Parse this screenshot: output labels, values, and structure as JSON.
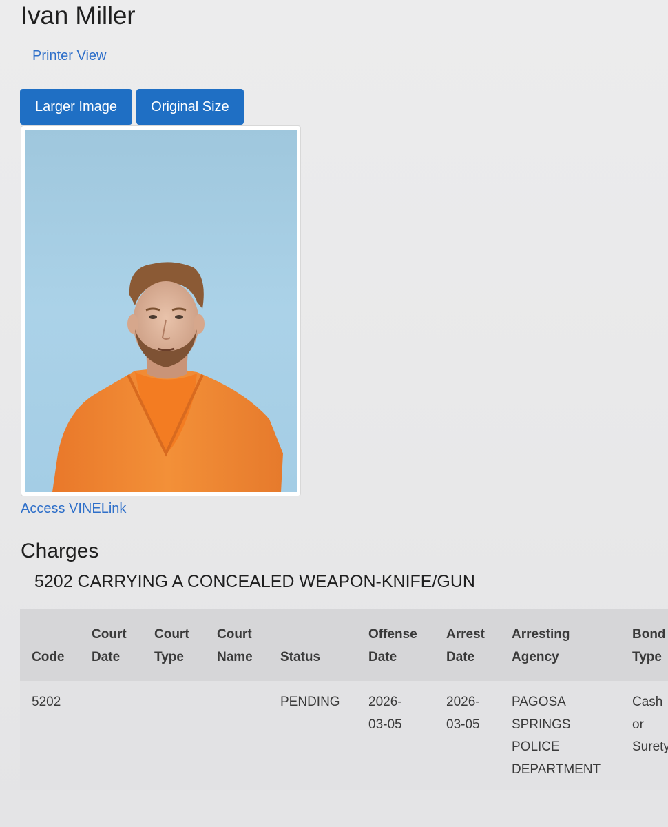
{
  "header": {
    "name": "Ivan Miller",
    "printer_link": "Printer View"
  },
  "buttons": {
    "larger_image": "Larger Image",
    "original_size": "Original Size"
  },
  "links": {
    "vinelink": "Access VINELink"
  },
  "charges": {
    "heading": "Charges",
    "charge_title": "5202 CARRYING A CONCEALED WEAPON-KNIFE/GUN",
    "columns": [
      {
        "line1": "",
        "line2": "Code"
      },
      {
        "line1": "Court",
        "line2": "Date"
      },
      {
        "line1": "Court",
        "line2": "Type"
      },
      {
        "line1": "Court",
        "line2": "Name"
      },
      {
        "line1": "",
        "line2": "Status"
      },
      {
        "line1": "Offense",
        "line2": "Date"
      },
      {
        "line1": "Arrest",
        "line2": "Date"
      },
      {
        "line1": "Arresting",
        "line2": "Agency"
      },
      {
        "line1": "Bond",
        "line2": "Type"
      }
    ],
    "row": {
      "code": "5202",
      "court_date": "",
      "court_type": "",
      "court_name": "",
      "status": "PENDING",
      "offense_date": [
        "2026-",
        "03-05"
      ],
      "arrest_date": [
        "2026-",
        "03-05"
      ],
      "arresting_agency": [
        "PAGOSA",
        "SPRINGS",
        "POLICE",
        "DEPARTMENT"
      ],
      "bond_type": [
        "Cash",
        "or",
        "Surety"
      ]
    }
  },
  "colors": {
    "link": "#2e6fc9",
    "button": "#1f6fc4",
    "photo_background": "#a9d0e6",
    "jumpsuit": "#f08a2c"
  }
}
